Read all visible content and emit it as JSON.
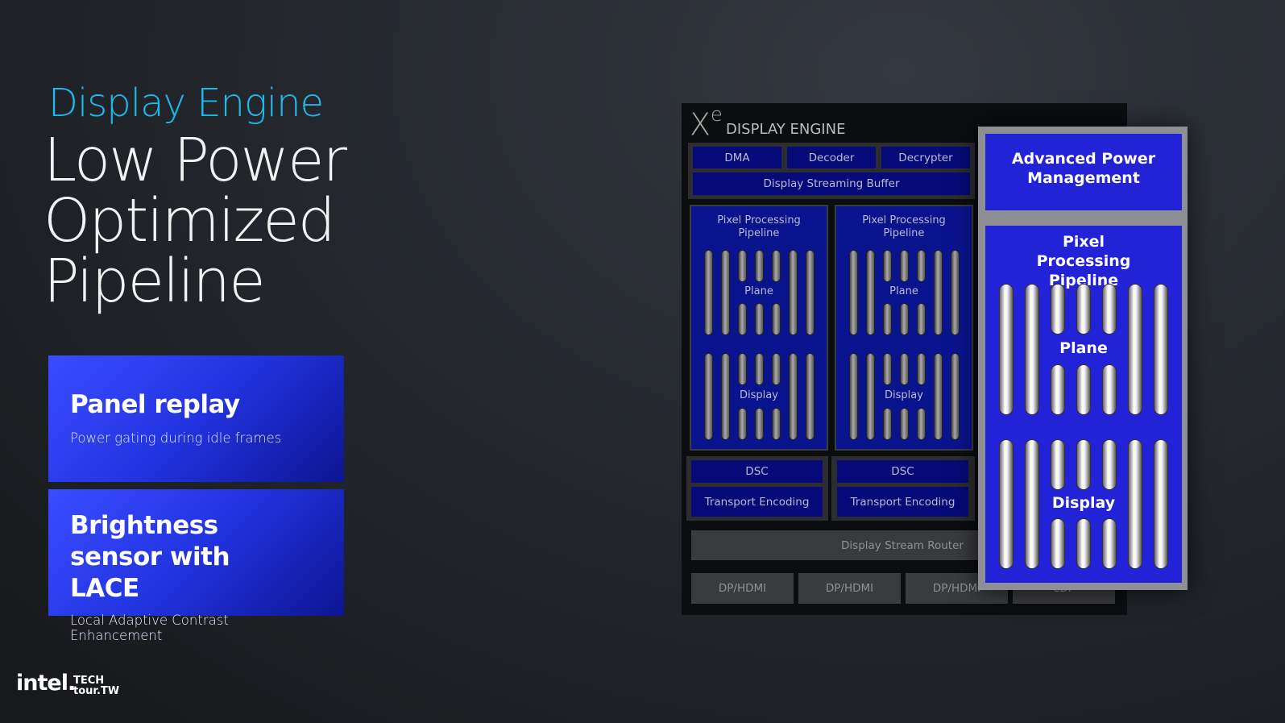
{
  "slide": {
    "kicker": "Display Engine",
    "title_lines": [
      "Low Power",
      "Optimized",
      "Pipeline"
    ]
  },
  "cards": [
    {
      "title": "Panel replay",
      "subtitle": "Power gating during idle frames"
    },
    {
      "title": "Brightness sensor with LACE",
      "subtitle": "Local Adaptive Contrast Enhancement"
    }
  ],
  "diagram": {
    "brand_mark": "X",
    "brand_sup": "e",
    "title": "DISPLAY ENGINE",
    "top_blocks": [
      "DMA",
      "Decoder",
      "Decrypter"
    ],
    "buffer": "Display Streaming Buffer",
    "pipelines": [
      {
        "label": "Pixel Processing Pipeline",
        "plane": "Plane",
        "display": "Display"
      },
      {
        "label": "Pixel Processing Pipeline",
        "plane": "Plane",
        "display": "Display"
      }
    ],
    "dsc": [
      "DSC",
      "DSC"
    ],
    "transport": [
      "Transport Encoding",
      "Transport Encoding"
    ],
    "router": "Display Stream Router",
    "ports": [
      "DP/HDMI",
      "DP/HDMI",
      "DP/HDMI",
      "eDP"
    ],
    "highlight": {
      "apm": "Advanced Power Management",
      "pipeline": "Pixel Processing Pipeline",
      "plane": "Plane",
      "display": "Display"
    },
    "colors": {
      "accent": "#1fb8ea",
      "block_blue": "#050a78",
      "highlight_blue": "#2222d6"
    }
  },
  "footer": {
    "logo": "intel.",
    "event_logo": "TECH tour.TW"
  }
}
